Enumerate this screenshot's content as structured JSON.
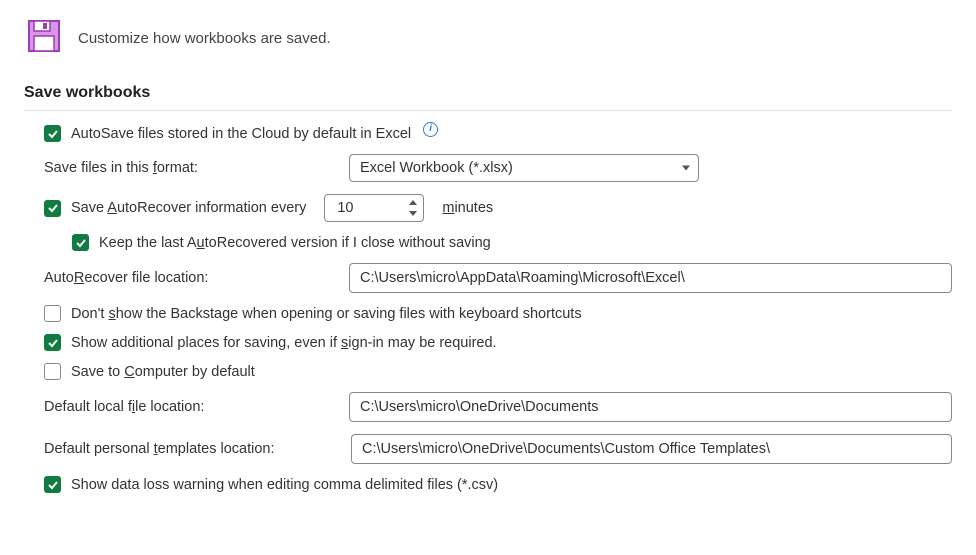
{
  "header": {
    "description": "Customize how workbooks are saved."
  },
  "section": {
    "title": "Save workbooks"
  },
  "options": {
    "autosave_cloud": {
      "label_pre": "AutoSave files stored in the Cloud by default in Excel",
      "checked": true
    },
    "save_format": {
      "label": "Save files in this format:",
      "value": "Excel Workbook (*.xlsx)"
    },
    "autorecover": {
      "label_pre": "Save AutoRecover information every",
      "minutes_value": "10",
      "minutes_label": "minutes",
      "checked": true
    },
    "keep_last": {
      "label": "Keep the last AutoRecovered version if I close without saving",
      "checked": true
    },
    "autorecover_location": {
      "label": "AutoRecover file location:",
      "value": "C:\\Users\\micro\\AppData\\Roaming\\Microsoft\\Excel\\"
    },
    "dont_show_backstage": {
      "label": "Don't show the Backstage when opening or saving files with keyboard shortcuts",
      "checked": false
    },
    "show_additional": {
      "label": "Show additional places for saving, even if sign-in may be required.",
      "checked": true
    },
    "save_to_computer": {
      "label": "Save to Computer by default",
      "checked": false
    },
    "default_local": {
      "label": "Default local file location:",
      "value": "C:\\Users\\micro\\OneDrive\\Documents"
    },
    "default_templates": {
      "label": "Default personal templates location:",
      "value": "C:\\Users\\micro\\OneDrive\\Documents\\Custom Office Templates\\"
    },
    "show_data_loss": {
      "label": "Show data loss warning when editing comma delimited files (*.csv)",
      "checked": true
    }
  }
}
